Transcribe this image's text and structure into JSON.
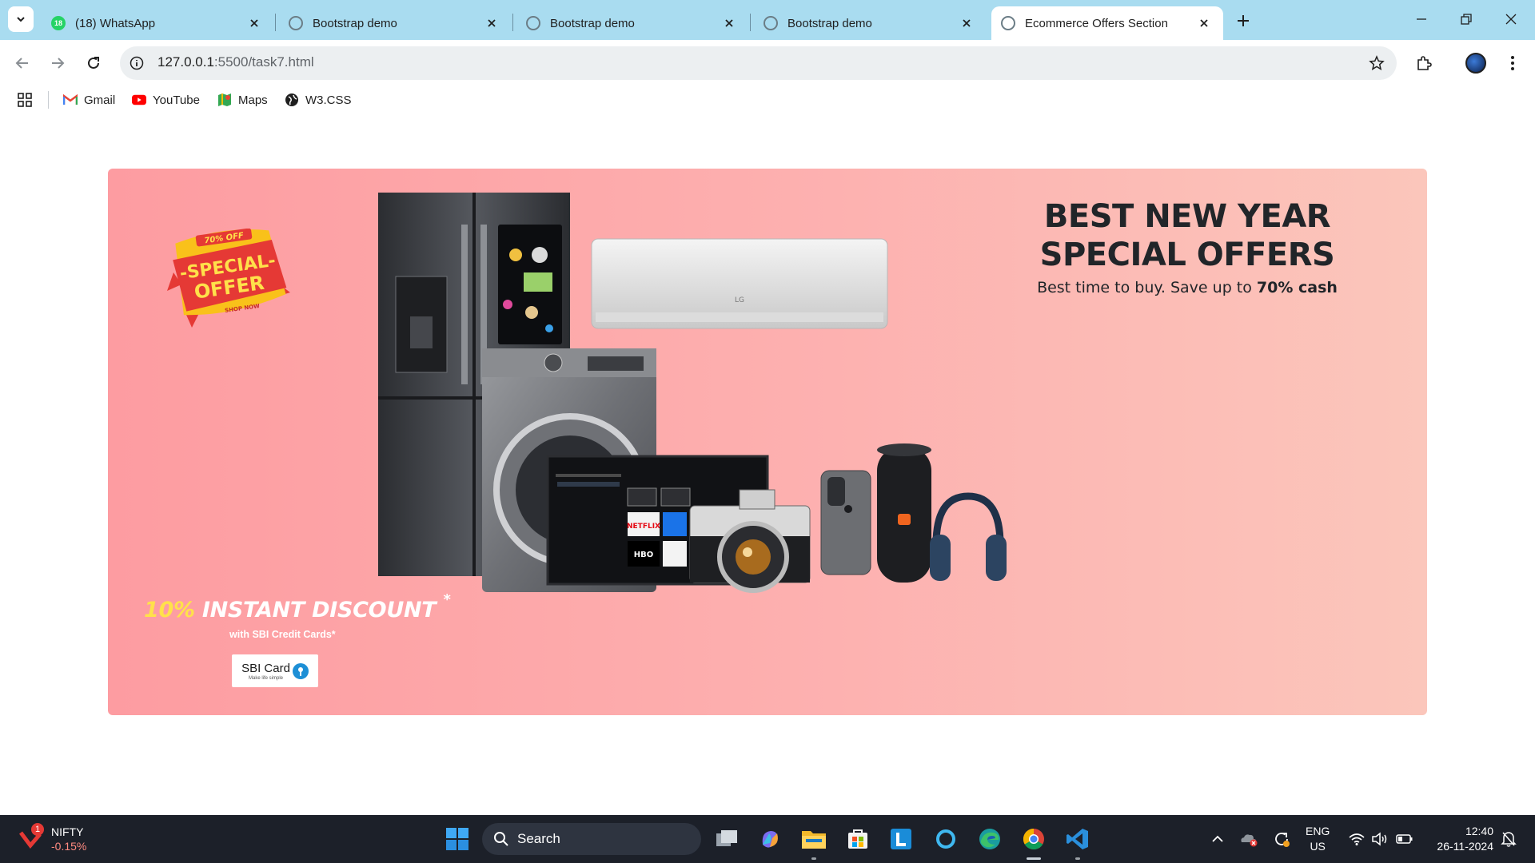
{
  "browser": {
    "tabs": [
      {
        "title": "(18) WhatsApp",
        "badge": "18",
        "active": false
      },
      {
        "title": "Bootstrap demo",
        "active": false
      },
      {
        "title": "Bootstrap demo",
        "active": false
      },
      {
        "title": "Bootstrap demo",
        "active": false
      },
      {
        "title": "Ecommerce Offers Section",
        "active": true
      }
    ],
    "url_host": "127.0.0.1",
    "url_rest": ":5500/task7.html",
    "bookmarks": [
      {
        "label": "Gmail",
        "icon": "gmail-icon"
      },
      {
        "label": "YouTube",
        "icon": "youtube-icon"
      },
      {
        "label": "Maps",
        "icon": "maps-icon"
      },
      {
        "label": "W3.CSS",
        "icon": "globe-icon"
      }
    ]
  },
  "offer": {
    "heading": "BEST NEW YEAR SPECIAL OFFERS",
    "subtitle_prefix": "Best time to buy. Save up to ",
    "subtitle_bold": "70% cash",
    "badge": {
      "top": "70% OFF",
      "line1": "-SPECIAL-",
      "line2": "OFFER",
      "bottom": "SHOP NOW"
    },
    "discount_pct": "10%",
    "discount_text": " INSTANT DISCOUNT",
    "discount_star": "*",
    "card_caption": "with SBI Credit Cards*",
    "card_logo": "SBI Card",
    "card_tagline": "Make life simple"
  },
  "taskbar": {
    "ticker_name": "NIFTY",
    "ticker_change": "-0.15%",
    "ticker_notifications": "1",
    "search_label": "Search",
    "lang_line1": "ENG",
    "lang_line2": "US",
    "time": "12:40",
    "date": "26-11-2024"
  },
  "colors": {
    "tabstrip": "#a9dcf0",
    "banner_start": "#fd9ca1",
    "banner_end": "#fbc6bb",
    "heading": "#212529",
    "discount_highlight": "#ffe14a",
    "taskbar": "#1c2029"
  }
}
